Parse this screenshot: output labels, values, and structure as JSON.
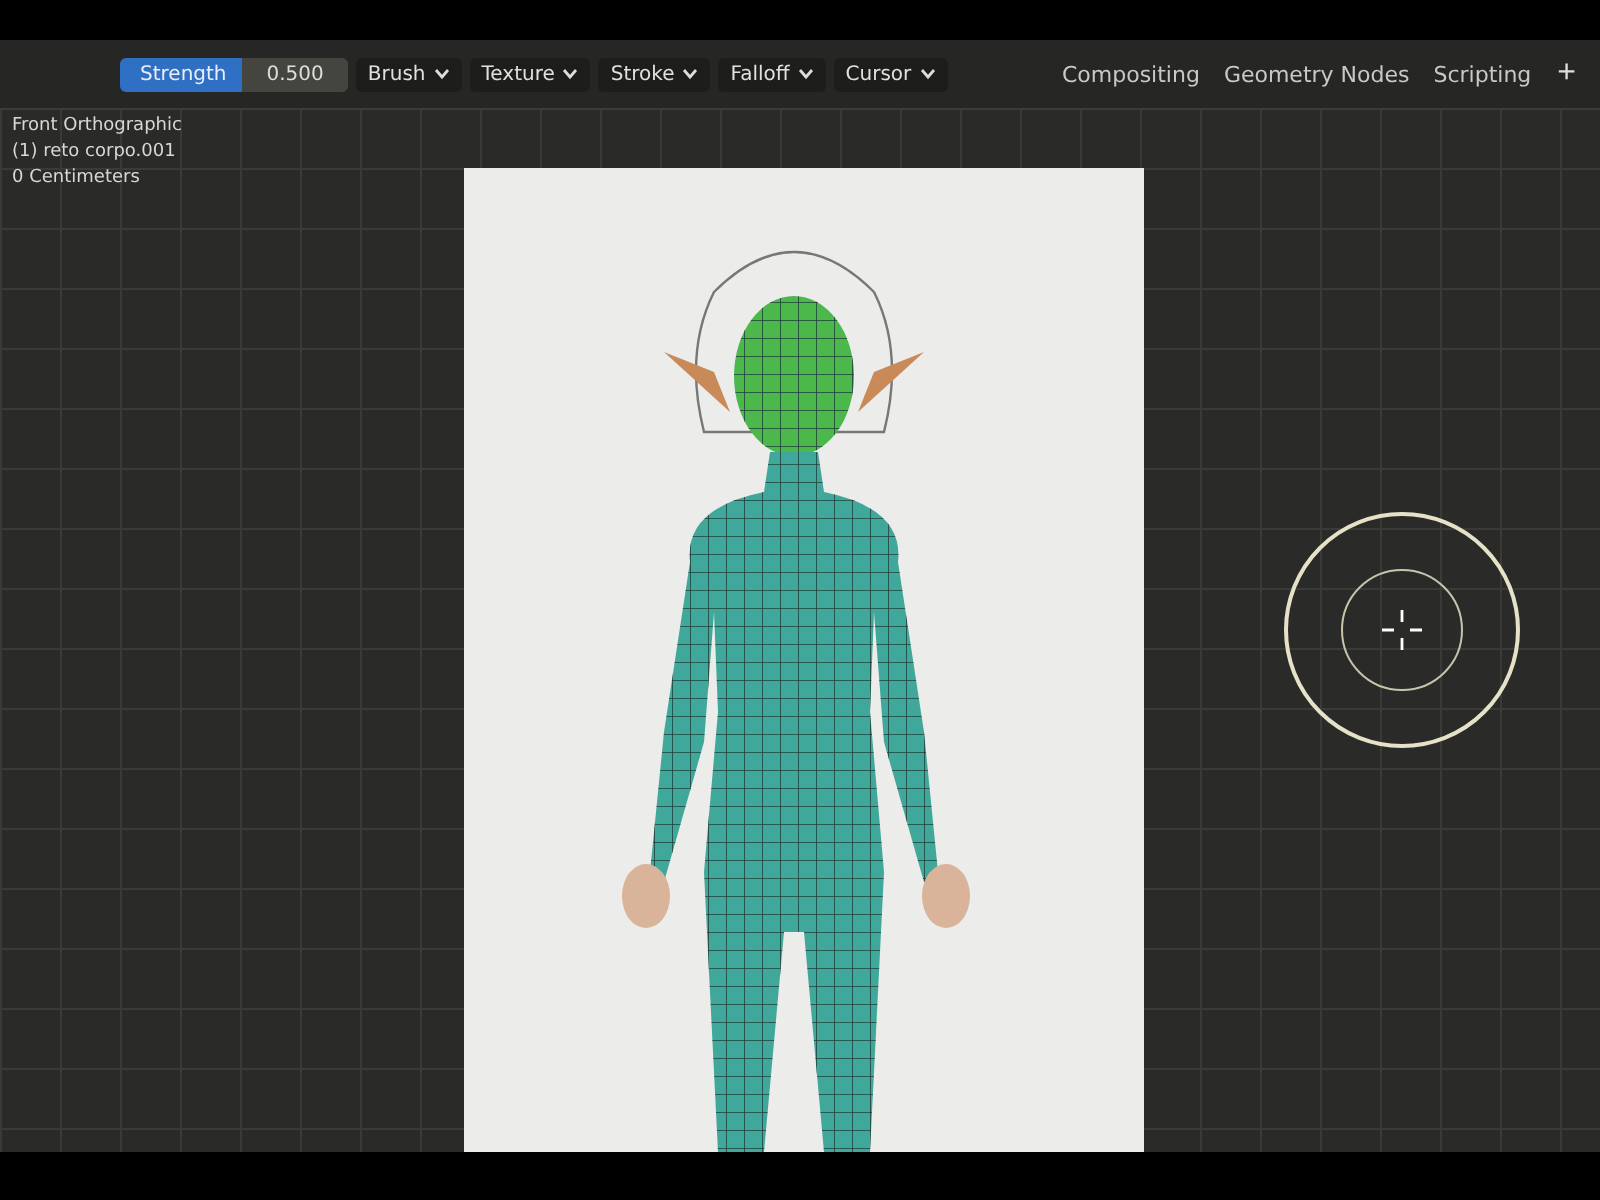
{
  "header": {
    "strength": {
      "label": "Strength",
      "value": "0.500"
    },
    "menus": [
      {
        "label": "Brush"
      },
      {
        "label": "Texture"
      },
      {
        "label": "Stroke"
      },
      {
        "label": "Falloff"
      },
      {
        "label": "Cursor"
      }
    ]
  },
  "workspace_tabs": [
    {
      "label": "Compositing",
      "selected": false
    },
    {
      "label": "Geometry Nodes",
      "selected": false
    },
    {
      "label": "Scripting",
      "selected": false
    }
  ],
  "add_tab": "+",
  "viewport": {
    "overlay": [
      "Front Orthographic",
      "(1) reto corpo.001",
      "0 Centimeters"
    ]
  }
}
